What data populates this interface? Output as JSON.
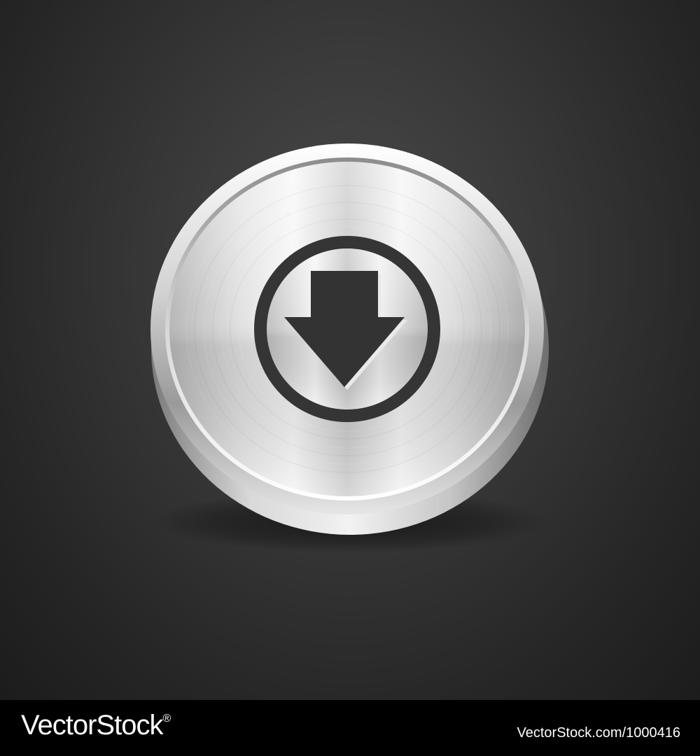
{
  "button": {
    "icon": "download-arrow-icon"
  },
  "colors": {
    "background": "#333333",
    "metal_light": "#f4f4f4",
    "metal_mid": "#c8c8c8",
    "metal_dark": "#8a8a8a",
    "icon": "#333333"
  },
  "footer": {
    "brand": "VectorStock",
    "brand_mark": "®",
    "caption": "VectorStock.com/1000416"
  }
}
